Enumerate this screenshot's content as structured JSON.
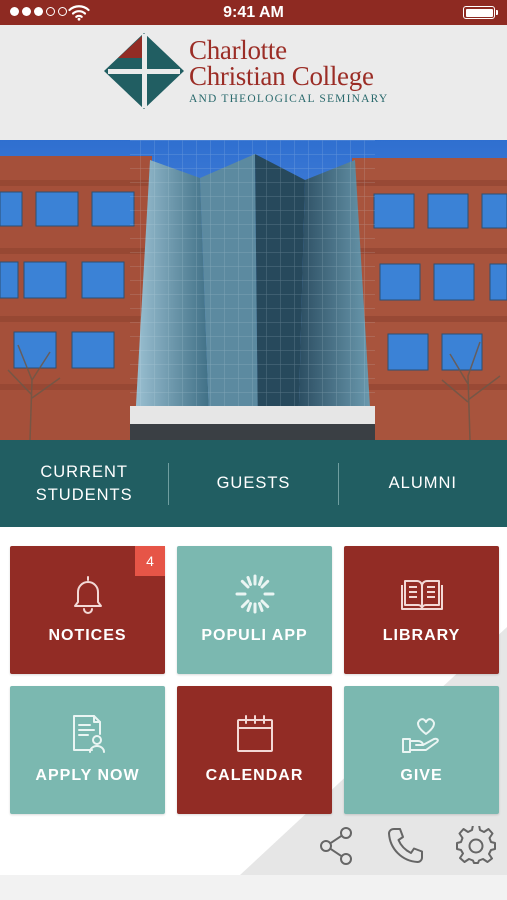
{
  "status_bar": {
    "time": "9:41 AM",
    "signal_icon": "signal-dots-icon",
    "wifi_icon": "wifi-icon",
    "battery_icon": "battery-icon",
    "colors": {
      "background": "#8e2a22"
    }
  },
  "header": {
    "logo_icon": "college-cross-logo-icon",
    "name_line1": "Charlotte",
    "name_line2": "Christian College",
    "subtitle": "AND THEOLOGICAL SEMINARY"
  },
  "hero": {
    "image_icon": "campus-building-photo"
  },
  "audience_nav": {
    "items": [
      {
        "label_line1": "CURRENT",
        "label_line2": "STUDENTS"
      },
      {
        "label_line1": "GUESTS",
        "label_line2": ""
      },
      {
        "label_line1": "ALUMNI",
        "label_line2": ""
      }
    ],
    "colors": {
      "background": "#215e62"
    }
  },
  "tiles": [
    {
      "label": "NOTICES",
      "icon": "bell-icon",
      "color": "#922c25",
      "badge": "4"
    },
    {
      "label": "POPULI APP",
      "icon": "populi-icon",
      "color": "#7bb8b0"
    },
    {
      "label": "LIBRARY",
      "icon": "book-icon",
      "color": "#922c25"
    },
    {
      "label": "APPLY NOW",
      "icon": "application-form-icon",
      "color": "#7bb8b0"
    },
    {
      "label": "CALENDAR",
      "icon": "calendar-icon",
      "color": "#922c25"
    },
    {
      "label": "GIVE",
      "icon": "giving-hand-heart-icon",
      "color": "#7bb8b0"
    }
  ],
  "utility_icons": [
    "share-icon",
    "phone-icon",
    "settings-gear-icon"
  ]
}
